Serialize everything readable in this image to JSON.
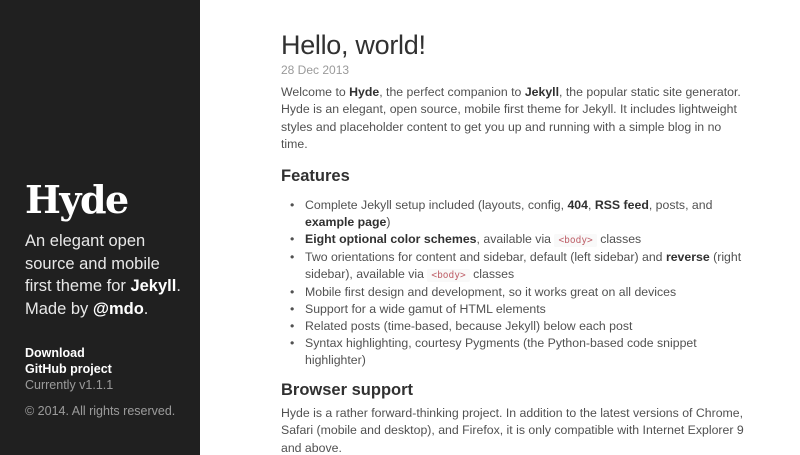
{
  "sidebar": {
    "brand": "Hyde",
    "lead": {
      "text_pre": "An elegant open source and mobile first theme for ",
      "jekyll": "Jekyll",
      "text_mid": ". Made by ",
      "mdo": "@mdo",
      "text_post": "."
    },
    "nav": {
      "download": "Download",
      "github": "GitHub project",
      "version": "Currently v1.1.1"
    },
    "copyright": "© 2014. All rights reserved."
  },
  "post": {
    "title": "Hello, world!",
    "date": "28 Dec 2013",
    "intro": {
      "p1": "Welcome to ",
      "hyde": "Hyde",
      "p2": ", the perfect companion to ",
      "jekyll": "Jekyll",
      "p3": ", the popular static site generator. Hyde is an elegant, open source, mobile first theme for Jekyll. It includes lightweight styles and placeholder content to get you up and running with a simple blog in no time."
    },
    "features_heading": "Features",
    "features": {
      "f1": {
        "a": "Complete Jekyll setup included (layouts, config, ",
        "b1": "404",
        "c": ", ",
        "b2": "RSS feed",
        "d": ", posts, and ",
        "b3": "example page",
        "e": ")"
      },
      "f2": {
        "b": "Eight optional color schemes",
        "a": ", available via ",
        "code": "<body>",
        "c": " classes"
      },
      "f3": {
        "a": "Two orientations for content and sidebar, default (left sidebar) and ",
        "b": "reverse",
        "c": " (right sidebar), available via ",
        "code": "<body>",
        "d": " classes"
      },
      "f4": "Mobile first design and development, so it works great on all devices",
      "f5": "Support for a wide gamut of HTML elements",
      "f6": "Related posts (time-based, because Jekyll) below each post",
      "f7": "Syntax highlighting, courtesy Pygments (the Python-based code snippet highlighter)"
    },
    "browser_heading": "Browser support",
    "browser_text": "Hyde is a rather forward-thinking project. In addition to the latest versions of Chrome, Safari (mobile and desktop), and Firefox, it is only compatible with Internet Explorer 9 and above."
  },
  "colors": {
    "sidebar_bg": "#202020",
    "text": "#515151",
    "heading": "#313131",
    "code": "#bf616a"
  }
}
